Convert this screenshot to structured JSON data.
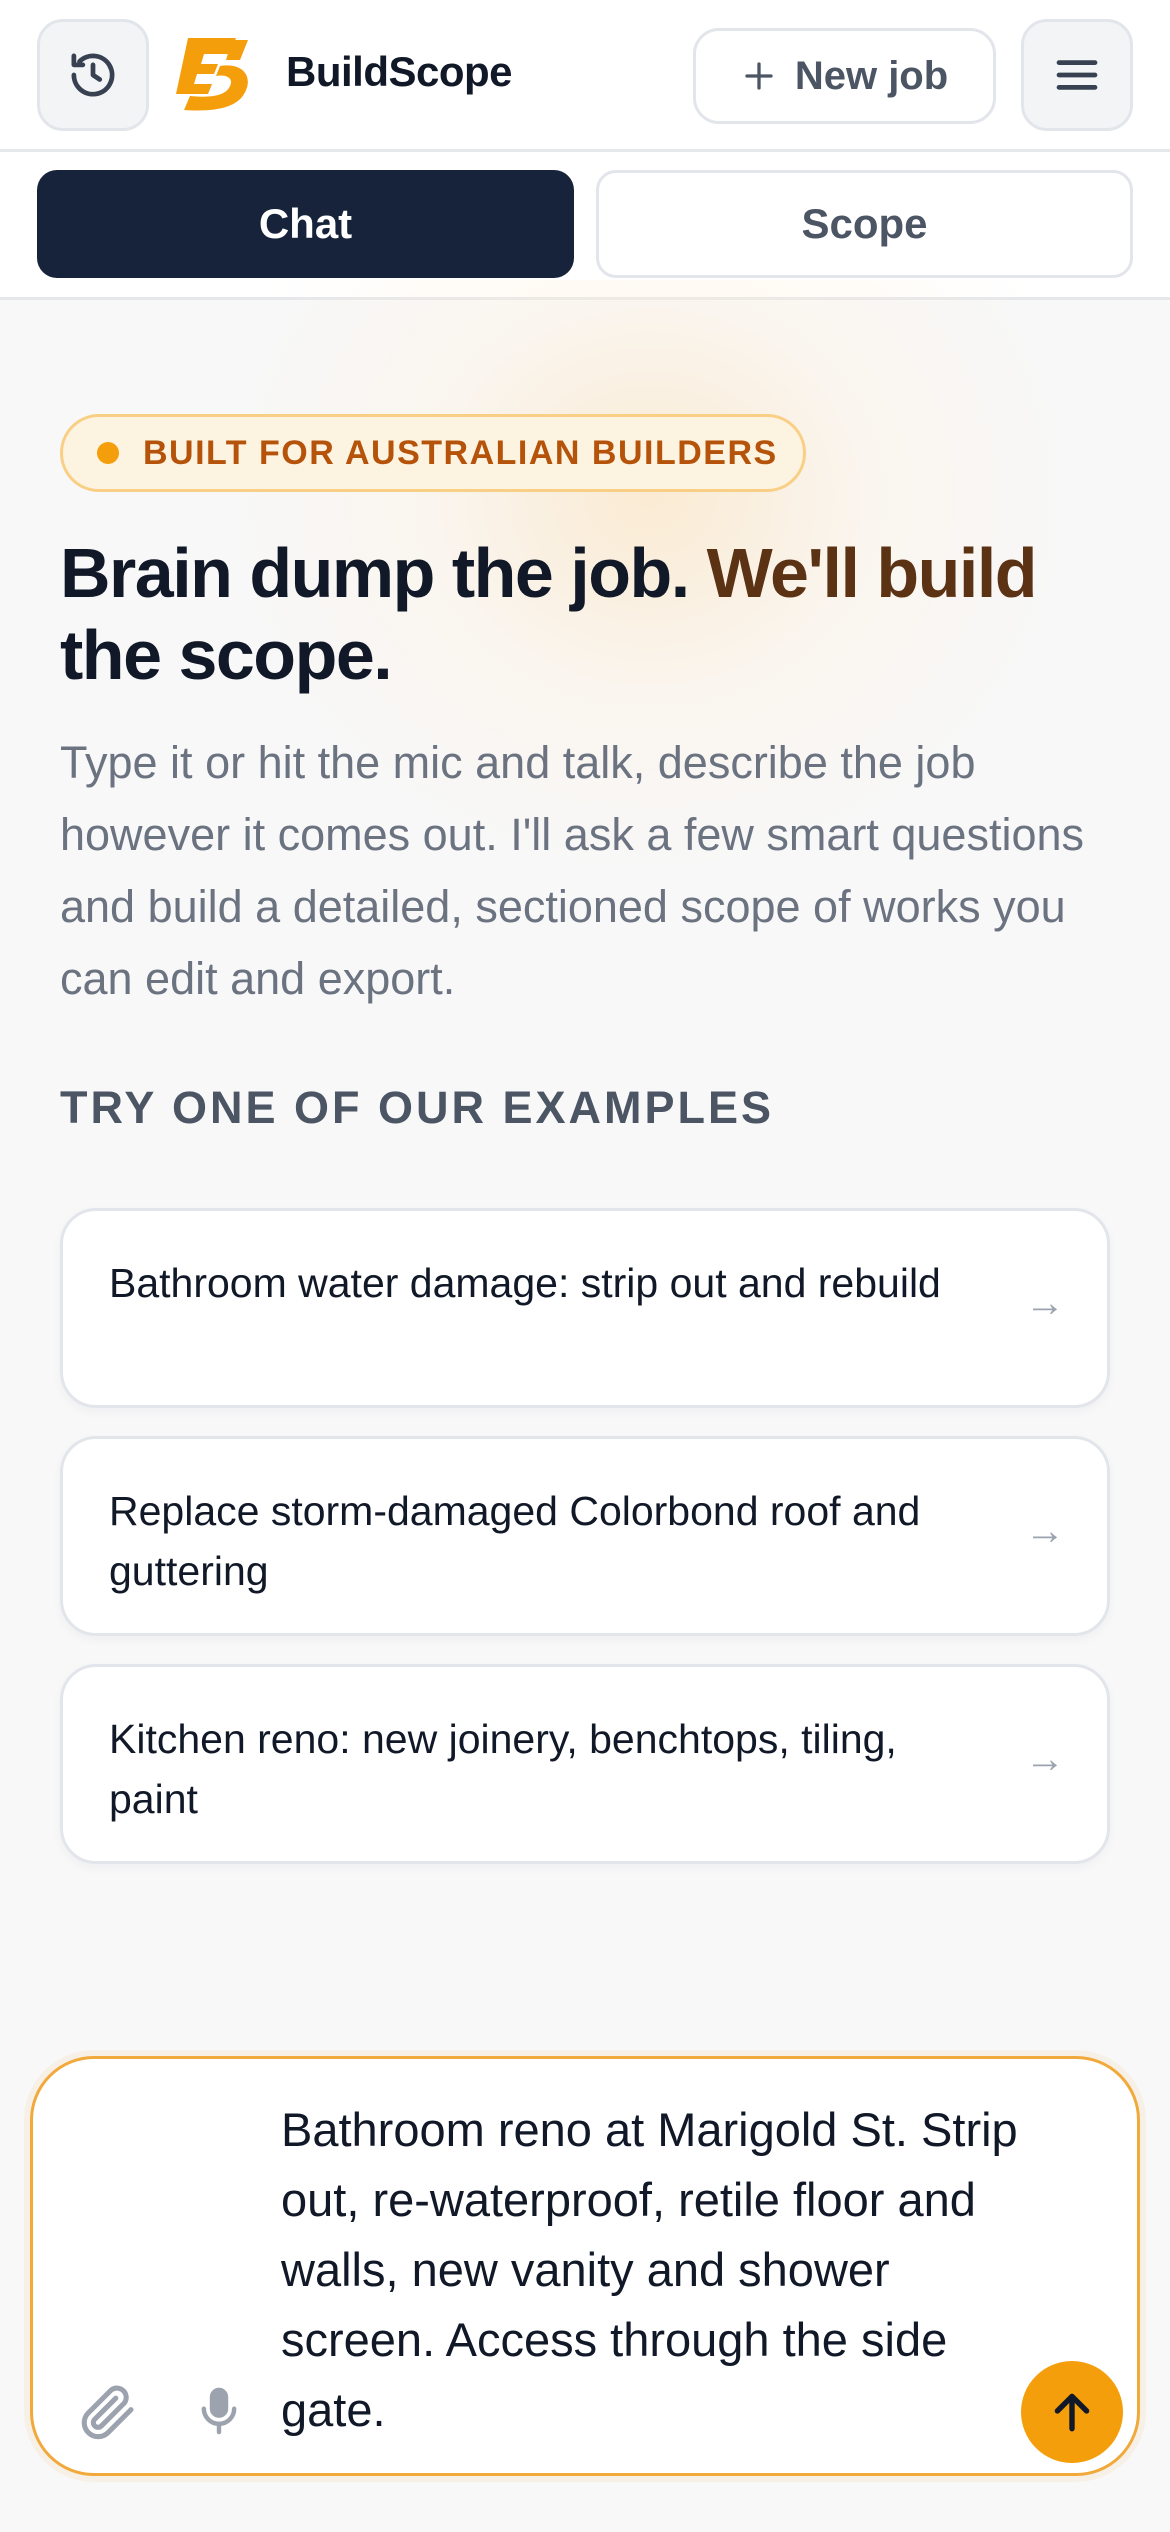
{
  "header": {
    "brand": "BuildScope",
    "new_job_label": "New job",
    "icons": {
      "history": "history-icon",
      "logo": "buildscope-logo",
      "plus": "plus-icon",
      "menu": "hamburger-icon"
    }
  },
  "tabs": [
    {
      "label": "Chat",
      "active": true
    },
    {
      "label": "Scope",
      "active": false
    }
  ],
  "hero": {
    "badge": "BUILT FOR AUSTRALIAN BUILDERS",
    "headline_main": "Brain dump the job.",
    "headline_accent": "We'll build",
    "headline_end": "the scope.",
    "subtext": "Type it or hit the mic and talk, describe the job however it comes out. I'll ask a few smart questions and build a detailed, sectioned scope of works you can edit and export."
  },
  "examples": {
    "heading": "TRY ONE OF OUR EXAMPLES",
    "items": [
      {
        "label": "Bathroom water damage: strip out and rebuild",
        "arrow": "→"
      },
      {
        "label": "Replace storm-damaged Colorbond roof and guttering",
        "arrow": "→"
      },
      {
        "label": "Kitchen reno: new joinery, benchtops, tiling, paint",
        "arrow": "→"
      }
    ]
  },
  "composer": {
    "value": "Bathroom reno at Marigold St. Strip out, re-waterproof, retile floor and walls, new vanity and shower screen. Access through the side gate.",
    "icons": {
      "attach": "paperclip-icon",
      "mic": "microphone-icon",
      "send": "arrow-up-icon"
    }
  },
  "colors": {
    "navy": "#16233a",
    "accent": "#f59e0b",
    "accent_text": "#b45309",
    "headline_accent": "#5b3214"
  }
}
